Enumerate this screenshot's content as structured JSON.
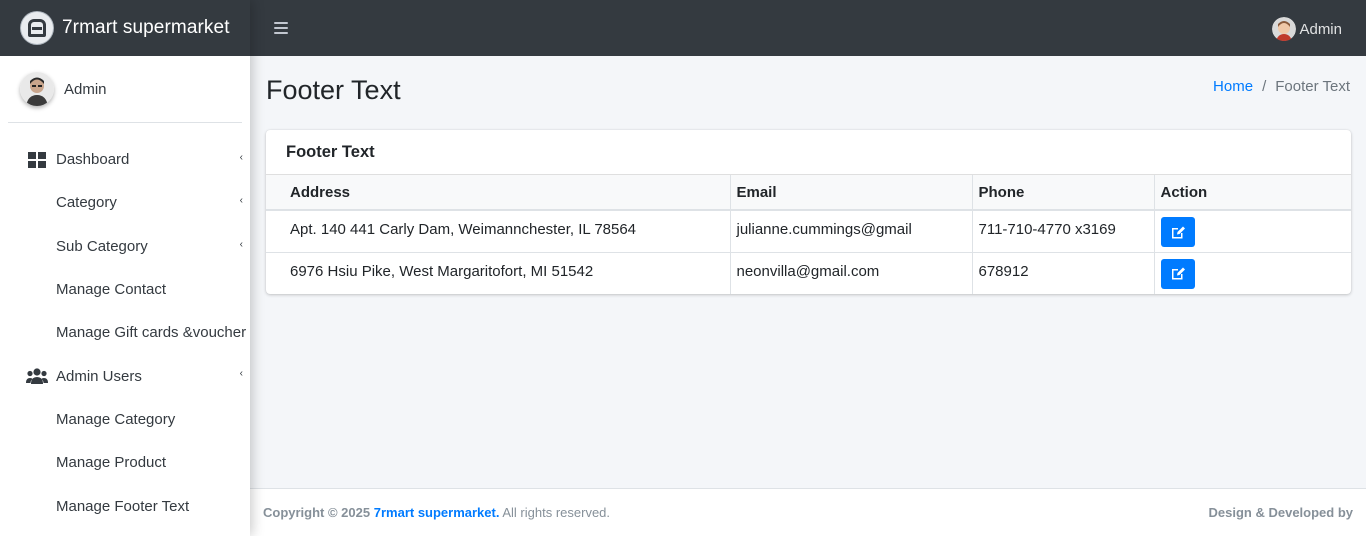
{
  "brand": {
    "name": "7rmart supermarket"
  },
  "sidebar": {
    "user": "Admin",
    "items": [
      {
        "label": "Dashboard"
      },
      {
        "label": "Category"
      },
      {
        "label": "Sub Category"
      },
      {
        "label": "Manage Contact"
      },
      {
        "label": "Manage Gift cards &voucher"
      },
      {
        "label": "Admin Users"
      },
      {
        "label": "Manage Category"
      },
      {
        "label": "Manage Product"
      },
      {
        "label": "Manage Footer Text"
      }
    ]
  },
  "topbar": {
    "user": "Admin"
  },
  "page": {
    "title": "Footer Text",
    "breadcrumb": {
      "home": "Home",
      "separator": "/",
      "current": "Footer Text"
    }
  },
  "card": {
    "title": "Footer Text",
    "columns": [
      "Address",
      "Email",
      "Phone",
      "Action"
    ],
    "rows": [
      {
        "address": "Apt. 140 441 Carly Dam, Weimannchester, IL 78564",
        "email": "julianne.cummings@gmail",
        "phone": "711-710-4770 x3169",
        "action_icon": "edit-icon"
      },
      {
        "address": "6976 Hsiu Pike, West Margaritofort, MI 51542",
        "email": "neonvilla@gmail.com",
        "phone": "678912",
        "action_icon": "edit-icon"
      }
    ]
  },
  "footer": {
    "copyright": "Copyright © 2025",
    "brand_link": "7rmart supermarket.",
    "rights": "All rights reserved.",
    "credit": "Design & Developed by"
  },
  "colors": {
    "topbar": "#343a40",
    "accent": "#007bff",
    "background": "#f4f6f9"
  }
}
